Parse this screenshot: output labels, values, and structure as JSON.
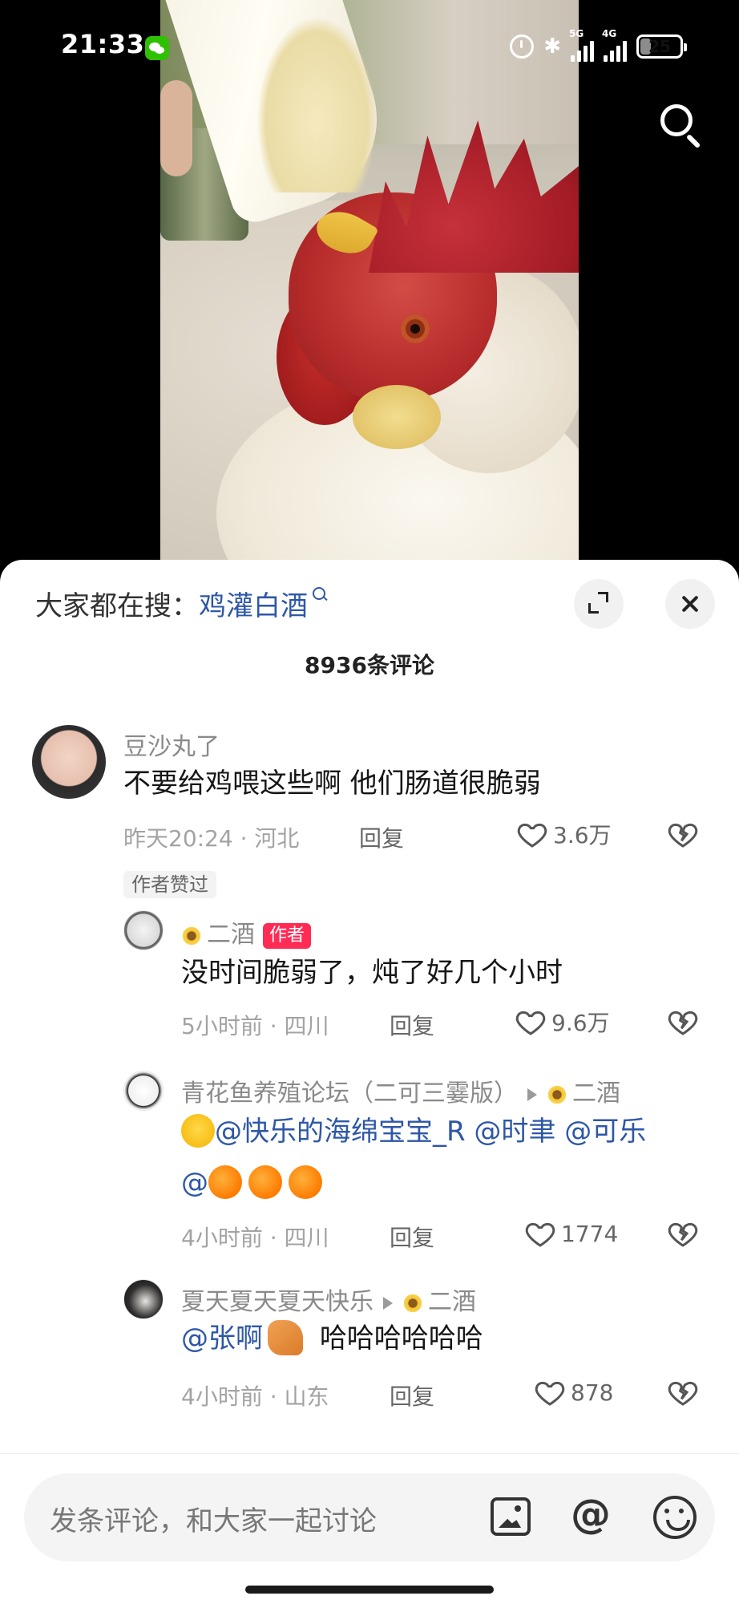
{
  "status_bar": {
    "time": "21:33",
    "net1": "5G",
    "net2": "4G",
    "battery": "25",
    "battery_percent": 25
  },
  "search_hint": {
    "prefix": "大家都在搜：",
    "keyword": "鸡灌白酒"
  },
  "comment_count": "8936条评论",
  "comments": [
    {
      "username": "豆沙丸了",
      "text": "不要给鸡喂这些啊  他们肠道很脆弱",
      "time_location": "昨天20:24 · 河北",
      "reply_label": "回复",
      "likes": "3.6万",
      "badge": "作者赞过"
    }
  ],
  "replies": [
    {
      "username": "二酒",
      "author_tag": "作者",
      "text": "没时间脆弱了，炖了好几个小时",
      "time_location": "5小时前 · 四川",
      "reply_label": "回复",
      "likes": "9.6万"
    },
    {
      "username": "青花鱼养殖论坛（二可三霎版）",
      "reply_to": "二酒",
      "text_line1": "@快乐的海绵宝宝_R @时聿 @可乐",
      "text_line2": "@",
      "time_location": "4小时前 · 四川",
      "reply_label": "回复",
      "likes": "1774"
    },
    {
      "username": "夏天夏天夏天快乐",
      "reply_to": "二酒",
      "mention": "@张啊",
      "text": "哈哈哈哈哈哈",
      "time_location": "4小时前 · 山东",
      "reply_label": "回复",
      "likes": "878"
    }
  ],
  "input_bar": {
    "placeholder": "发条评论，和大家一起讨论",
    "at_symbol": "@"
  },
  "icons": {
    "heart": "heart-icon",
    "dislike": "broken-heart-icon",
    "search": "search-icon",
    "close": "close-icon",
    "expand": "expand-icon"
  },
  "colors": {
    "accent_link": "#2e57a6",
    "author_tag": "#fe2c55",
    "wechat": "#2dc100"
  }
}
